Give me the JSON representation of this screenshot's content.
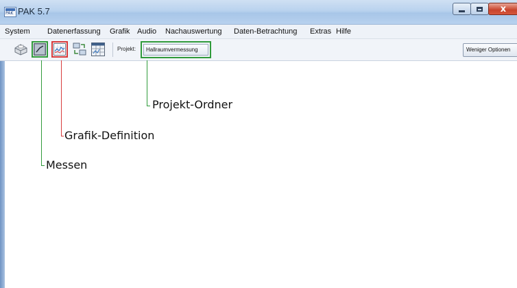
{
  "window": {
    "title": "PAK 5.7",
    "app_icon_text": "PAK",
    "controls": {
      "minimize_icon": "minimize-icon",
      "maximize_icon": "maximize-icon",
      "close_icon": "close-icon",
      "close_glyph": "x"
    }
  },
  "menu": {
    "items": [
      "System",
      "Datenerfassung",
      "Grafik",
      "Audio",
      "Nachauswertung",
      "Daten-Betrachtung",
      "Extras",
      "Hilfe"
    ]
  },
  "toolbar": {
    "tools": [
      "printer-icon",
      "measure-icon",
      "graph-definition-icon",
      "transfer-icon",
      "grid-icon"
    ],
    "project_label": "Projekt:",
    "project_value": "Hallraumvermessung",
    "fewer_options_label": "Weniger Optionen"
  },
  "annotations": {
    "project_folder": "Projekt-Ordner",
    "graph_definition": "Grafik-Definition",
    "measure": "Messen"
  },
  "colors": {
    "highlight_green": "#2f9a3a",
    "highlight_red": "#d83a3a",
    "title_bar": "#b9d2ee",
    "close_button": "#c8442c"
  }
}
